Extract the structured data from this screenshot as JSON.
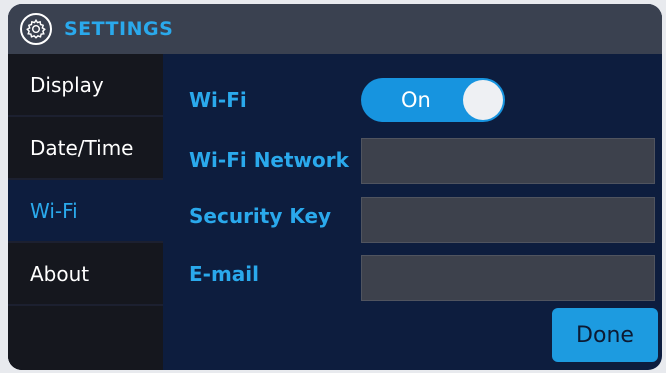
{
  "header": {
    "icon": "gear-icon",
    "title": "SETTINGS"
  },
  "sidebar": {
    "items": [
      {
        "label": "Display",
        "active": false
      },
      {
        "label": "Date/Time",
        "active": false
      },
      {
        "label": "Wi-Fi",
        "active": true
      },
      {
        "label": "About",
        "active": false
      }
    ]
  },
  "main": {
    "wifi_label": "Wi-Fi",
    "wifi_toggle": {
      "state_label": "On",
      "on": true
    },
    "network_label": "Wi-Fi Network",
    "network_value": "",
    "security_label": "Security Key",
    "security_value": "",
    "email_label": "E-mail",
    "email_value": "",
    "done_label": "Done"
  },
  "colors": {
    "accent": "#2aa9ec",
    "panel_bg": "#0d1d3e",
    "header_bg": "#3a4150",
    "field_bg": "#3d414c",
    "button_bg": "#1d9be0"
  }
}
